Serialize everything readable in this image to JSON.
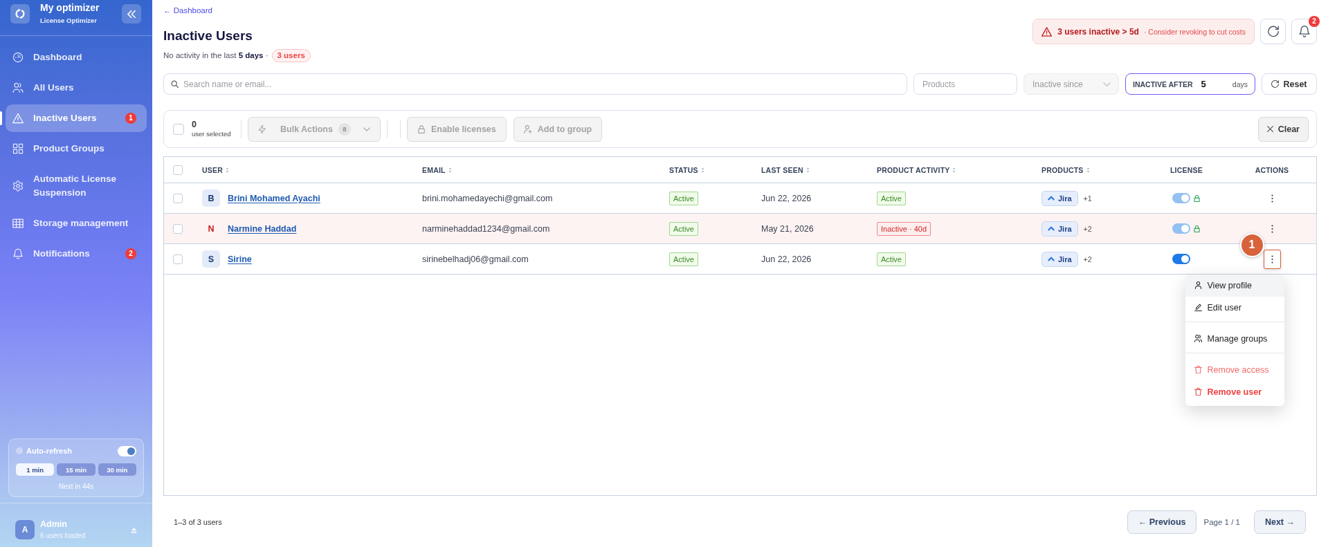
{
  "sidebar": {
    "brand": {
      "title": "My optimizer",
      "subtitle": "License Optimizer"
    },
    "nav": [
      {
        "label": "Dashboard",
        "selected": false
      },
      {
        "label": "All Users",
        "selected": false
      },
      {
        "label": "Inactive Users",
        "selected": true,
        "badge": "1"
      },
      {
        "label": "Product Groups",
        "selected": false
      },
      {
        "label": "Automatic License Suspension",
        "selected": false
      },
      {
        "label": "Storage management",
        "selected": false
      },
      {
        "label": "Notifications",
        "selected": false,
        "badge": "2"
      }
    ],
    "auto_refresh": {
      "label": "Auto-refresh",
      "on": true,
      "intervals": [
        {
          "label": "1 min",
          "selected": true
        },
        {
          "label": "15 min",
          "selected": false
        },
        {
          "label": "30 min",
          "selected": false
        }
      ],
      "countdown": "Next in 44s"
    },
    "account": {
      "initial": "A",
      "name": "Admin",
      "detail": "6 users loaded"
    }
  },
  "header": {
    "back_link": "← Dashboard",
    "title": "Inactive Users",
    "subtitle": "No activity in the last **5 days** ·",
    "count_badge": "3 users",
    "alert": {
      "headline": "3 users inactive > 5d",
      "detail": "· Consider revoking to cut costs"
    },
    "notification_count": "2"
  },
  "filters": {
    "search": {
      "placeholder": "Search name or email..."
    },
    "products": {
      "placeholder": "Products"
    },
    "inactive_since": {
      "placeholder": "Inactive since",
      "disabled": true
    },
    "inactive_after": {
      "label": "INACTIVE AFTER",
      "value": "5",
      "unit": "days"
    },
    "reset": "Reset"
  },
  "bulk_bar": {
    "checked": false,
    "count": "0",
    "count_label": "user selected",
    "actions": [
      {
        "label": "Bulk Actions",
        "badge": "8",
        "disabled": true
      },
      {
        "label": "Enable licenses",
        "disabled": true
      },
      {
        "label": "Add to group",
        "disabled": true
      }
    ],
    "clear": "Clear"
  },
  "table": {
    "all_checked": false,
    "columns": [
      {
        "label": "USER",
        "sortable": true
      },
      {
        "label": "EMAIL",
        "sortable": true
      },
      {
        "label": "STATUS",
        "sortable": true
      },
      {
        "label": "LAST SEEN",
        "sortable": true
      },
      {
        "label": "PRODUCT ACTIVITY",
        "sortable": true
      },
      {
        "label": "PRODUCTS",
        "sortable": true
      },
      {
        "label": "LICENSE",
        "sortable": false
      },
      {
        "label": "ACTIONS",
        "sortable": false
      }
    ],
    "rows": [
      {
        "checked": false,
        "flagged": false,
        "initial": "B",
        "name": "Brini Mohamed Ayachi",
        "email": "brini.mohamedayechi@gmail.com",
        "status": {
          "label": "Active",
          "kind": "ok"
        },
        "last_seen": "Jun 22, 2026",
        "activity": {
          "label": "Active",
          "kind": "ok"
        },
        "product": {
          "name": "Jira",
          "more": "+1"
        },
        "license": {
          "on": true,
          "locked": true
        },
        "menu_open": false
      },
      {
        "checked": false,
        "flagged": true,
        "initial": "N",
        "name": "Narmine Haddad",
        "email": "narminehaddad1234@gmail.com",
        "status": {
          "label": "Active",
          "kind": "ok"
        },
        "last_seen": "May 21, 2026",
        "activity": {
          "label": "Inactive · 40d",
          "kind": "bad"
        },
        "product": {
          "name": "Jira",
          "more": "+2"
        },
        "license": {
          "on": true,
          "locked": true
        },
        "menu_open": false
      },
      {
        "checked": false,
        "flagged": false,
        "initial": "S",
        "name": "Sirine",
        "email": "sirinebelhadj06@gmail.com",
        "status": {
          "label": "Active",
          "kind": "ok"
        },
        "last_seen": "Jun 22, 2026",
        "activity": {
          "label": "Active",
          "kind": "ok"
        },
        "product": {
          "name": "Jira",
          "more": "+2"
        },
        "license": {
          "on": true,
          "locked": false
        },
        "menu_open": true
      }
    ]
  },
  "row_menu": {
    "items": [
      {
        "label": "View profile",
        "kind": "plain",
        "highlighted": true,
        "separated": false
      },
      {
        "label": "Edit user",
        "kind": "plain",
        "highlighted": false,
        "separated": false
      },
      {
        "label": "Manage groups",
        "kind": "plain",
        "highlighted": false,
        "separated": true
      },
      {
        "label": "Remove access",
        "kind": "caution",
        "highlighted": false,
        "separated": true
      },
      {
        "label": "Remove user",
        "kind": "danger",
        "highlighted": false,
        "separated": false
      }
    ]
  },
  "callout": "1",
  "pagination": {
    "summary": "1–3 of 3 users",
    "previous": "← Previous",
    "page": "Page 1 / 1",
    "next": "Next →"
  }
}
